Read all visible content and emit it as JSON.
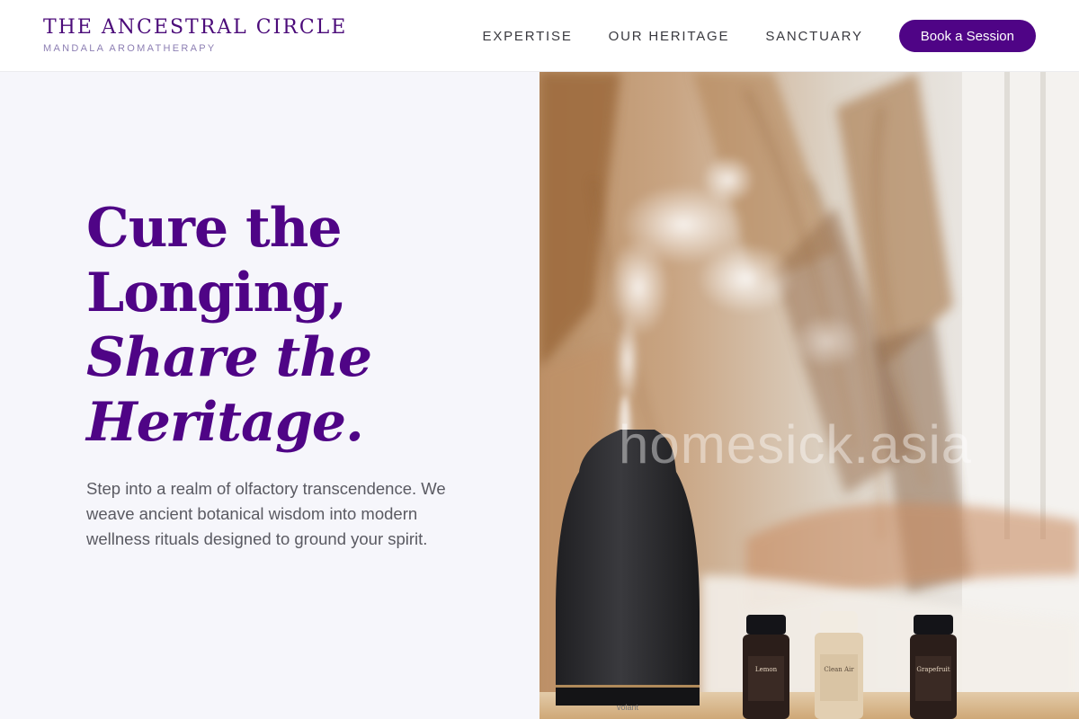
{
  "brand": {
    "name": "THE ANCESTRAL CIRCLE",
    "tagline": "MANDALA AROMATHERAPY"
  },
  "nav": {
    "items": [
      {
        "label": "EXPERTISE"
      },
      {
        "label": "OUR HERITAGE"
      },
      {
        "label": "SANCTUARY"
      }
    ],
    "cta_label": "Book a Session"
  },
  "hero": {
    "title_line1": "Cure the",
    "title_line2": "Longing,",
    "title_line3": "Share the",
    "title_line4": "Heritage.",
    "description": "Step into a realm of olfactory transcendence. We weave ancient botanical wisdom into modern wellness rituals designed to ground your spirit."
  },
  "image": {
    "watermark": "homesick.asia",
    "diffuser_label": "volant",
    "bottles": [
      {
        "label": "Lemon"
      },
      {
        "label": "Clean Air"
      },
      {
        "label": "Grapefruit"
      }
    ]
  },
  "colors": {
    "brand_purple": "#4f0486",
    "hero_bg": "#f6f6fb",
    "body_text": "#5a5a62"
  }
}
